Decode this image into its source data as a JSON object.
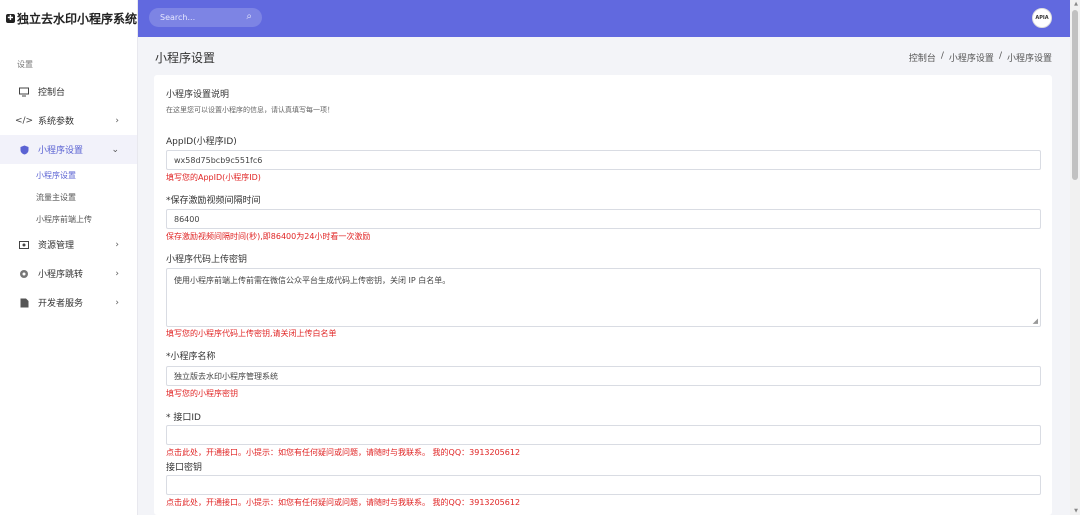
{
  "app": {
    "brand": "独立去水印小程序系统",
    "brand_icon": "shield-icon"
  },
  "header": {
    "search_placeholder": "Search...",
    "avatar_text": "APIA",
    "accent": "#6169df"
  },
  "sidebar": {
    "section": "设置",
    "items": [
      {
        "label": "控制台",
        "icon": "monitor-icon",
        "has_children": false
      },
      {
        "label": "系统参数",
        "icon": "code-icon",
        "has_children": true
      },
      {
        "label": "小程序设置",
        "icon": "shield-icon",
        "has_children": true,
        "expanded": true
      },
      {
        "label": "资源管理",
        "icon": "image-icon",
        "has_children": true
      },
      {
        "label": "小程序跳转",
        "icon": "gear-icon",
        "has_children": true
      },
      {
        "label": "开发者服务",
        "icon": "file-icon",
        "has_children": true
      }
    ],
    "subitems": [
      "小程序设置",
      "流量主设置",
      "小程序前端上传"
    ]
  },
  "page": {
    "title": "小程序设置",
    "breadcrumb": [
      "控制台",
      "/",
      "小程序设置",
      "/",
      "小程序设置"
    ]
  },
  "form": {
    "intro_title": "小程序设置说明",
    "intro_desc": "在这里您可以设置小程序的信息，请认真填写每一项！",
    "fields": [
      {
        "label": "AppID(小程序ID)",
        "value": "wx58d75bcb9c551fc6",
        "hint": "填写您的AppID(小程序ID)"
      },
      {
        "label": "*保存激励视频间隔时间",
        "value": "86400",
        "hint": "保存激励视频间隔时间(秒),即86400为24小时看一次激励"
      },
      {
        "label": "小程序代码上传密钥",
        "value": "使用小程序前端上传前需在微信公众平台生成代码上传密钥，关闭 IP 白名单。",
        "hint": "填写您的小程序代码上传密钥,请关闭上传白名单"
      },
      {
        "label": "*小程序名称",
        "value": "独立版去水印小程序管理系统",
        "hint": "填写您的小程序密钥"
      },
      {
        "label": "* 接口ID",
        "value": "",
        "hint": "点击此处，开通接口。小提示：如您有任何疑问或问题，请随时与我联系。 我的QQ：3913205612"
      },
      {
        "label": "接口密钥",
        "value": "",
        "hint": "点击此处，开通接口。小提示：如您有任何疑问或问题，请随时与我联系。 我的QQ：3913205612"
      }
    ]
  },
  "colors": {
    "hint": "#e02424",
    "active": "#5b63d3"
  }
}
